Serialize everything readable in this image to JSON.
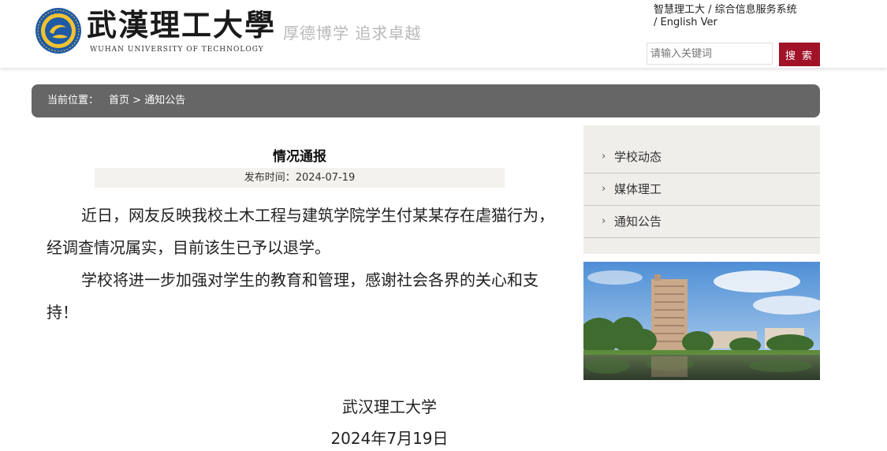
{
  "header": {
    "brand_cn": "武漢理工大學",
    "brand_en": "WUHAN UNIVERSITY OF TECHNOLOGY",
    "motto": "厚德博学  追求卓越",
    "links": {
      "smart": "智慧理工大",
      "sep1": " / ",
      "info": "综合信息服务系统",
      "sep2": " / ",
      "english": "English Ver"
    },
    "search": {
      "placeholder": "请输入关键词",
      "button": "搜 索"
    }
  },
  "breadcrumb": {
    "label": "当前位置：",
    "home": "首页",
    "separator": ">",
    "current": "通知公告"
  },
  "article": {
    "title": "情况通报",
    "date": "发布时间：2024-07-19",
    "paragraphs": [
      "近日，网友反映我校土木工程与建筑学院学生付某某存在虐猫行为，经调查情况属实，目前该生已予以退学。",
      "学校将进一步加强对学生的教育和管理，感谢社会各界的关心和支持！"
    ],
    "signature": "武汉理工大学",
    "sign_date": "2024年7月19日"
  },
  "sidebar": {
    "items": [
      {
        "label": "学校动态"
      },
      {
        "label": "媒体理工"
      },
      {
        "label": "通知公告"
      }
    ]
  },
  "icons": {
    "chevron": "chevron-right-icon",
    "logo": "university-seal-logo"
  },
  "colors": {
    "accent": "#a11128",
    "crumbbar": "#666666",
    "sidebar_bg": "#efeeea",
    "datebar_bg": "#f4f2ec"
  }
}
